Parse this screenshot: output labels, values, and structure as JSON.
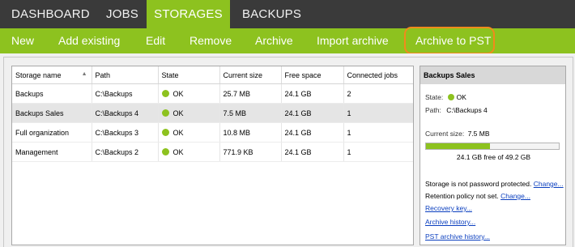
{
  "nav": {
    "tabs": [
      {
        "label": "DASHBOARD",
        "active": false
      },
      {
        "label": "JOBS",
        "active": false
      },
      {
        "label": "STORAGES",
        "active": true
      },
      {
        "label": "BACKUPS",
        "active": false
      }
    ]
  },
  "toolbar": {
    "buttons": [
      {
        "label": "New"
      },
      {
        "label": "Add existing"
      },
      {
        "label": "Edit"
      },
      {
        "label": "Remove"
      },
      {
        "label": "Archive"
      },
      {
        "label": "Import archive"
      },
      {
        "label": "Archive to PST"
      }
    ]
  },
  "table": {
    "columns": [
      "Storage name",
      "Path",
      "State",
      "Current size",
      "Free space",
      "Connected jobs"
    ],
    "rows": [
      {
        "name": "Backups",
        "path": "C:\\Backups",
        "state": "OK",
        "current_size": "25.7 MB",
        "free_space": "24.1 GB",
        "connected_jobs": "2"
      },
      {
        "name": "Backups Sales",
        "path": "C:\\Backups 4",
        "state": "OK",
        "current_size": "7.5 MB",
        "free_space": "24.1 GB",
        "connected_jobs": "1"
      },
      {
        "name": "Full organization",
        "path": "C:\\Backups 3",
        "state": "OK",
        "current_size": "10.8 MB",
        "free_space": "24.1 GB",
        "connected_jobs": "1"
      },
      {
        "name": "Management",
        "path": "C:\\Backups 2",
        "state": "OK",
        "current_size": "771.9 KB",
        "free_space": "24.1 GB",
        "connected_jobs": "1"
      }
    ]
  },
  "detail": {
    "title": "Backups Sales",
    "state_label": "State:",
    "state_value": "OK",
    "path_label": "Path:",
    "path_value": "C:\\Backups 4",
    "current_size_label": "Current size:",
    "current_size_value": "7.5 MB",
    "usage_fraction": 0.48,
    "free_text": "24.1 GB free of 49.2 GB",
    "password_text": "Storage is not password protected.",
    "password_link": "Change...",
    "retention_text": "Retention policy not set.",
    "retention_link": "Change...",
    "recovery_link": "Recovery key...",
    "archive_history_link": "Archive history...",
    "pst_history_link": "PST archive history..."
  },
  "colors": {
    "accent": "#8dc21f",
    "nav_bg": "#3a3a3a",
    "highlight": "#f28a1c",
    "link": "#0b3fbf"
  }
}
